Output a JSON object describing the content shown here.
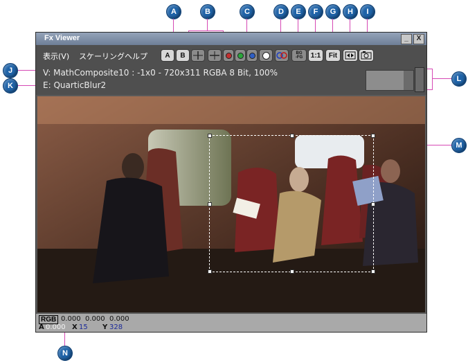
{
  "window": {
    "title": "Fx Viewer",
    "minimize_label": "_",
    "close_label": "X"
  },
  "menu": {
    "items": [
      "表示(V)",
      "スケーリング",
      "ヘルプ"
    ]
  },
  "toolbar": {
    "a_label": "A",
    "b_label": "B",
    "bgfg_label": "BG\n-FG",
    "one_to_one_label": "1:1",
    "fit_label": "Fit",
    "channel_colors": [
      "#c23030",
      "#2aa53a",
      "#2f5fc4",
      "#ffffff"
    ]
  },
  "info": {
    "line1": "V: MathComposite10 : -1x0 - 720x311 RGBA 8 Bit, 100%",
    "line2": "E: QuarticBlur2"
  },
  "status": {
    "rgb_label": "RGB",
    "rgb_values": "0.000  0.000  0.000",
    "a_label": "A",
    "a_value": "0.000",
    "x_label": "X",
    "x_value": "15",
    "y_label": "Y",
    "y_value": "328"
  },
  "callouts": [
    "A",
    "B",
    "C",
    "D",
    "E",
    "F",
    "G",
    "H",
    "I",
    "J",
    "K",
    "L",
    "M",
    "N"
  ],
  "colors": {
    "callout": "#1f63a8",
    "leader": "#d548b4",
    "window_bg": "#4f4f4f",
    "status_bg": "#a9a9a9"
  }
}
